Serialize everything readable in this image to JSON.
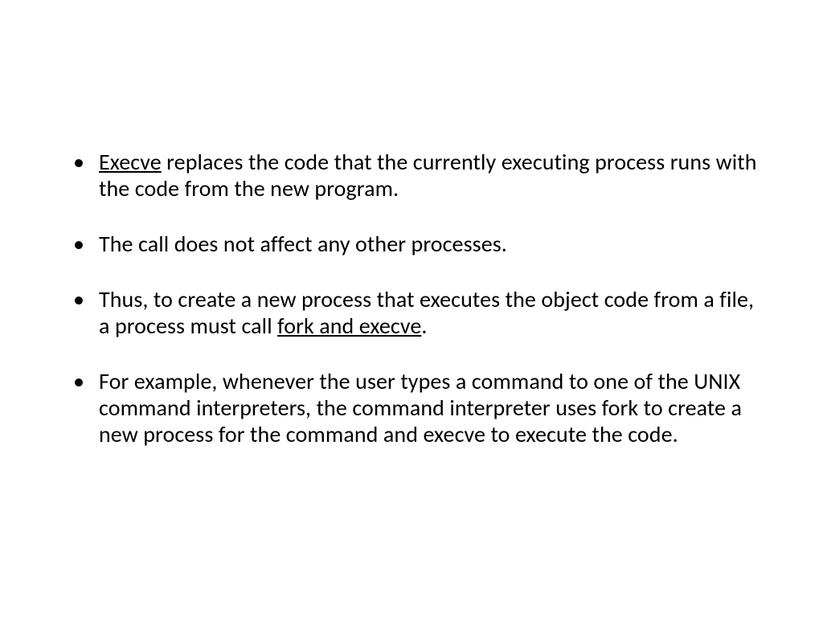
{
  "bullets": [
    {
      "segments": [
        {
          "text": "Execve",
          "underline": true
        },
        {
          "text": " replaces the code that the currently executing process runs with the code from the new program.",
          "underline": false
        }
      ]
    },
    {
      "segments": [
        {
          "text": "The call does not affect any other processes.",
          "underline": false
        }
      ]
    },
    {
      "segments": [
        {
          "text": "Thus, to create a new process that executes the object code from a file, a process must call ",
          "underline": false
        },
        {
          "text": "fork and execve",
          "underline": true
        },
        {
          "text": ".",
          "underline": false
        }
      ]
    },
    {
      "segments": [
        {
          "text": "For example, whenever the user types a command to one of the UNIX command interpreters, the command interpreter uses fork to create a new process for the command and execve to execute the code.",
          "underline": false
        }
      ]
    }
  ]
}
